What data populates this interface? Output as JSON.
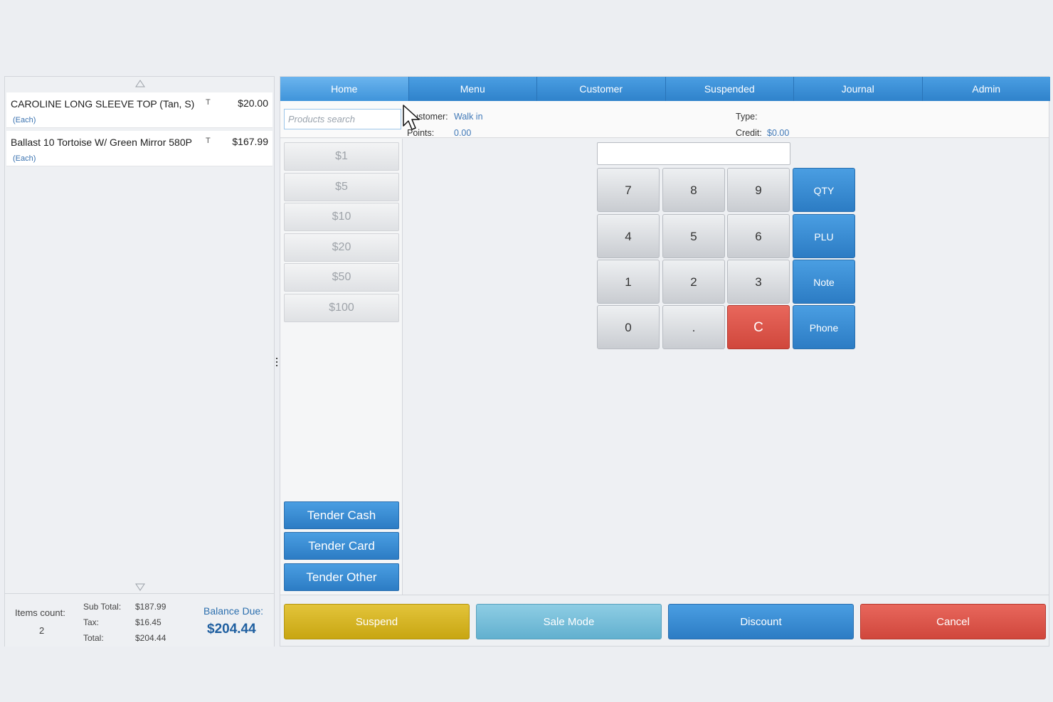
{
  "cart": {
    "items": [
      {
        "name": "CAROLINE LONG SLEEVE TOP (Tan, S)",
        "unit": "(Each)",
        "tax": "T",
        "price": "$20.00"
      },
      {
        "name": "Ballast 10 Tortoise W/ Green Mirror 580P",
        "unit": "(Each)",
        "tax": "T",
        "price": "$167.99"
      }
    ],
    "scroll_up_icon": "triangle-up-outline",
    "scroll_down_icon": "triangle-down-outline"
  },
  "summary": {
    "items_count_label": "Items count:",
    "items_count": "2",
    "subtotal_label": "Sub Total:",
    "subtotal": "$187.99",
    "tax_label": "Tax:",
    "tax": "$16.45",
    "total_label": "Total:",
    "total": "$204.44",
    "balance_label": "Balance Due:",
    "balance": "$204.44"
  },
  "tabs": [
    {
      "label": "Home",
      "active": true
    },
    {
      "label": "Menu"
    },
    {
      "label": "Customer"
    },
    {
      "label": "Suspended"
    },
    {
      "label": "Journal"
    },
    {
      "label": "Admin"
    }
  ],
  "search": {
    "placeholder": "Products search",
    "value": ""
  },
  "customer": {
    "customer_label": "Customer:",
    "customer_value": "Walk in",
    "points_label": "Points:",
    "points_value": "0.00",
    "type_label": "Type:",
    "type_value": "",
    "credit_label": "Credit:",
    "credit_value": "$0.00"
  },
  "quick_cash": [
    "$1",
    "$5",
    "$10",
    "$20",
    "$50",
    "$100"
  ],
  "tender": {
    "cash": "Tender Cash",
    "card": "Tender Card",
    "other": "Tender Other"
  },
  "keypad": {
    "display": "",
    "keys": [
      "7",
      "8",
      "9",
      "4",
      "5",
      "6",
      "1",
      "2",
      "3",
      "0",
      ".",
      "C"
    ],
    "functions": [
      "QTY",
      "PLU",
      "Note",
      "Phone"
    ]
  },
  "actions": {
    "suspend": "Suspend",
    "sale_mode": "Sale Mode",
    "discount": "Discount",
    "cancel": "Cancel"
  },
  "colors": {
    "primary_blue": "#3b8fd6",
    "suspend_yellow": "#d4b322",
    "sale_mode_teal": "#79c0da",
    "cancel_red": "#dc5a4f",
    "link_blue": "#3f78b7"
  }
}
